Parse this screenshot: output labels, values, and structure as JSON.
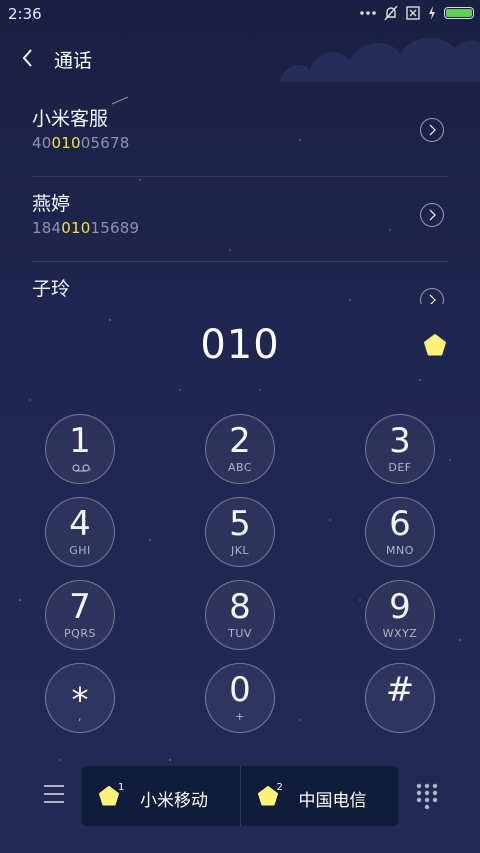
{
  "status_bar": {
    "time": "2:36"
  },
  "header": {
    "title": "通话"
  },
  "contacts": [
    {
      "name": "小米客服",
      "number_pre": "40",
      "number_match": "010",
      "number_post": "05678"
    },
    {
      "name": "燕婷",
      "number_pre": "184",
      "number_match": "010",
      "number_post": "15689"
    },
    {
      "name": "子玲",
      "number_pre": "",
      "number_match": "",
      "number_post": ""
    }
  ],
  "dial": {
    "input": "010"
  },
  "keypad": [
    {
      "num": "1",
      "sub": ""
    },
    {
      "num": "2",
      "sub": "ABC"
    },
    {
      "num": "3",
      "sub": "DEF"
    },
    {
      "num": "4",
      "sub": "GHI"
    },
    {
      "num": "5",
      "sub": "JKL"
    },
    {
      "num": "6",
      "sub": "MNO"
    },
    {
      "num": "7",
      "sub": "PQRS"
    },
    {
      "num": "8",
      "sub": "TUV"
    },
    {
      "num": "9",
      "sub": "WXYZ"
    },
    {
      "num": "⁎",
      "sub": ","
    },
    {
      "num": "0",
      "sub": "+"
    },
    {
      "num": "#",
      "sub": ""
    }
  ],
  "sims": [
    {
      "index": "1",
      "label": "小米移动"
    },
    {
      "index": "2",
      "label": "中国电信"
    }
  ],
  "colors": {
    "highlight": "#f3e43c",
    "star": "#fff27a",
    "battery": "#5fd34f",
    "sim_panel": "#0f1d3a"
  }
}
